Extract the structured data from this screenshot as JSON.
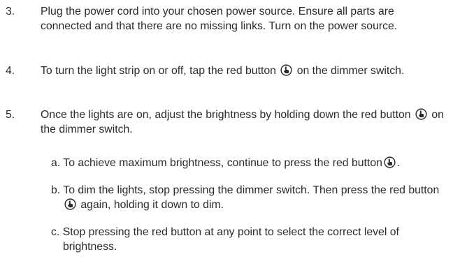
{
  "steps": [
    {
      "number": "3.",
      "text": "Plug the power cord into your chosen power source. Ensure all parts are connected and that there are no missing links. Turn on the power source."
    },
    {
      "number": "4.",
      "text_before": "To turn the light strip on or off, tap the red button",
      "text_after": "on the dimmer switch."
    },
    {
      "number": "5.",
      "text_before": "Once the lights are on, adjust the brightness by holding down the red button",
      "text_after": "on the dimmer switch."
    }
  ],
  "substeps": [
    {
      "label": "a.",
      "text_before": "To achieve maximum brightness, continue to press the red button",
      "text_after": "."
    },
    {
      "label": "b.",
      "text_before": "To dim the lights, stop pressing the dimmer switch. Then press the red button",
      "text_after": "again, holding it down to dim."
    },
    {
      "label": "c.",
      "text": "Stop pressing the red button at any point to select the correct level of brightness."
    }
  ],
  "icons": {
    "button": "hand-press-button-icon"
  }
}
